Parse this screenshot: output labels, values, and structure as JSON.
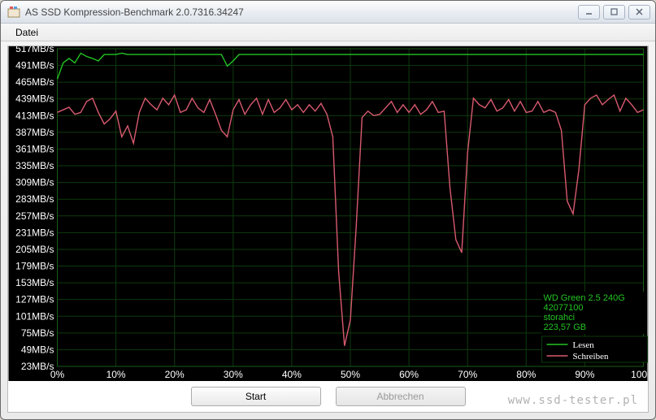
{
  "window": {
    "title": "AS SSD Kompression-Benchmark 2.0.7316.34247"
  },
  "menubar": {
    "file": "Datei"
  },
  "buttons": {
    "start": "Start",
    "abort": "Abbrechen"
  },
  "watermark": "www.ssd-tester.pl",
  "device": {
    "name": "WD Green 2.5 240G",
    "model": "42077100",
    "adapter": "storahci",
    "size": "223,57 GB"
  },
  "legend": {
    "read": "Lesen",
    "write": "Schreiben",
    "read_color": "#23c423",
    "write_color": "#d85a6f"
  },
  "chart_data": {
    "type": "line",
    "title": "",
    "xlabel": "",
    "ylabel": "",
    "x_ticks": [
      "0%",
      "10%",
      "20%",
      "30%",
      "40%",
      "50%",
      "60%",
      "70%",
      "80%",
      "90%",
      "100%"
    ],
    "y_ticks": [
      "23MB/s",
      "49MB/s",
      "75MB/s",
      "101MB/s",
      "127MB/s",
      "153MB/s",
      "179MB/s",
      "205MB/s",
      "231MB/s",
      "257MB/s",
      "283MB/s",
      "309MB/s",
      "335MB/s",
      "361MB/s",
      "387MB/s",
      "413MB/s",
      "439MB/s",
      "465MB/s",
      "491MB/s",
      "517MB/s"
    ],
    "xlim": [
      0,
      100
    ],
    "ylim": [
      23,
      517
    ],
    "x": [
      0,
      1,
      2,
      3,
      4,
      5,
      6,
      7,
      8,
      9,
      10,
      11,
      12,
      13,
      14,
      15,
      16,
      17,
      18,
      19,
      20,
      21,
      22,
      23,
      24,
      25,
      26,
      27,
      28,
      29,
      30,
      31,
      32,
      33,
      34,
      35,
      36,
      37,
      38,
      39,
      40,
      41,
      42,
      43,
      44,
      45,
      46,
      47,
      48,
      49,
      50,
      51,
      52,
      53,
      54,
      55,
      56,
      57,
      58,
      59,
      60,
      61,
      62,
      63,
      64,
      65,
      66,
      67,
      68,
      69,
      70,
      71,
      72,
      73,
      74,
      75,
      76,
      77,
      78,
      79,
      80,
      81,
      82,
      83,
      84,
      85,
      86,
      87,
      88,
      89,
      90,
      91,
      92,
      93,
      94,
      95,
      96,
      97,
      98,
      99,
      100
    ],
    "series": [
      {
        "name": "Lesen",
        "color": "#23c423",
        "values": [
          470,
          495,
          502,
          495,
          510,
          505,
          502,
          498,
          508,
          508,
          508,
          510,
          508,
          508,
          508,
          508,
          508,
          508,
          508,
          508,
          508,
          508,
          508,
          508,
          508,
          508,
          508,
          508,
          508,
          490,
          498,
          508,
          508,
          508,
          508,
          508,
          508,
          508,
          508,
          508,
          508,
          508,
          508,
          508,
          508,
          508,
          508,
          508,
          508,
          508,
          508,
          508,
          508,
          508,
          508,
          508,
          508,
          508,
          508,
          508,
          508,
          508,
          508,
          508,
          508,
          508,
          508,
          508,
          508,
          508,
          508,
          508,
          508,
          508,
          508,
          508,
          508,
          508,
          508,
          508,
          508,
          508,
          508,
          508,
          508,
          508,
          508,
          508,
          508,
          508,
          508,
          508,
          508,
          508,
          508,
          508,
          508,
          508,
          508,
          508,
          508
        ]
      },
      {
        "name": "Schreiben",
        "color": "#d85a6f",
        "values": [
          418,
          422,
          426,
          415,
          418,
          435,
          440,
          418,
          400,
          408,
          420,
          380,
          397,
          370,
          418,
          440,
          430,
          422,
          440,
          430,
          445,
          418,
          422,
          440,
          425,
          418,
          438,
          415,
          390,
          380,
          422,
          438,
          415,
          430,
          440,
          415,
          438,
          418,
          425,
          438,
          422,
          430,
          418,
          430,
          420,
          432,
          415,
          380,
          170,
          55,
          95,
          240,
          410,
          420,
          413,
          415,
          425,
          435,
          418,
          430,
          418,
          430,
          415,
          422,
          435,
          418,
          420,
          300,
          220,
          200,
          355,
          440,
          430,
          425,
          438,
          420,
          425,
          438,
          420,
          435,
          418,
          420,
          435,
          418,
          422,
          418,
          390,
          280,
          260,
          330,
          430,
          440,
          445,
          430,
          438,
          445,
          420,
          440,
          430,
          418,
          422
        ]
      }
    ]
  }
}
